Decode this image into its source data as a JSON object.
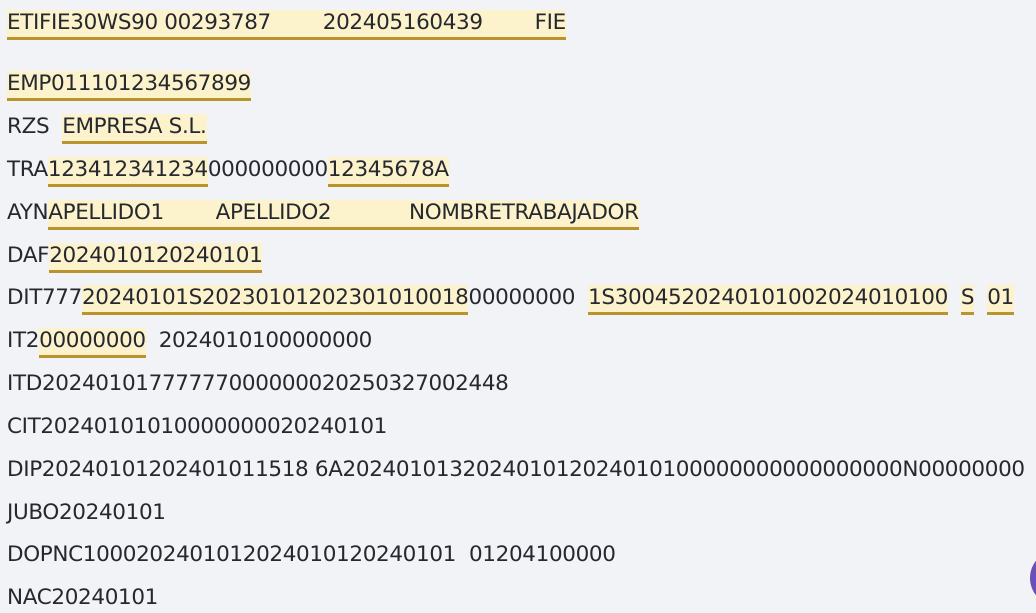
{
  "colors": {
    "background": "#f1f3f6",
    "highlight": "#fcf3cc",
    "underline": "#b9932e",
    "text": "#26282f",
    "fab": "#6a4fb8"
  },
  "lines": [
    [
      {
        "t": "ETIFIE30WS90 00293787        202405160439        FIE",
        "h": true
      }
    ],
    [
      {
        "t": "EMP01110123456789",
        "h": true
      },
      {
        "t": "9",
        "h": true
      }
    ],
    [
      {
        "t": "RZS  ",
        "h": false
      },
      {
        "t": "EMPRESA S.L.",
        "h": true
      }
    ],
    [
      {
        "t": "TRA",
        "h": false
      },
      {
        "t": "123412341234",
        "h": true
      },
      {
        "t": "000000000",
        "h": false
      },
      {
        "t": "12345678A",
        "h": true
      }
    ],
    [
      {
        "t": "AYN",
        "h": false
      },
      {
        "t": "APELLIDO1        APELLIDO2            NOMBRETRABAJADOR",
        "h": true
      }
    ],
    [
      {
        "t": "DAF",
        "h": false
      },
      {
        "t": "2024010120240101",
        "h": true
      }
    ],
    [
      {
        "t": "DIT777",
        "h": false
      },
      {
        "t": "20240101S20230101202301010018",
        "h": true
      },
      {
        "t": "00000000  ",
        "h": false
      },
      {
        "t": "1S3004520240101002024010100",
        "h": true
      },
      {
        "t": "  ",
        "h": false
      },
      {
        "t": "S",
        "h": true
      },
      {
        "t": "  ",
        "h": false
      },
      {
        "t": "01",
        "h": true
      }
    ],
    [
      {
        "t": "IT2",
        "h": false
      },
      {
        "t": "00000000",
        "h": true
      },
      {
        "t": "  2024010100000000",
        "h": false
      }
    ],
    [
      {
        "t": "ITD20240101777777000000020250327002448",
        "h": false
      }
    ],
    [
      {
        "t": "CIT20240101010000000020240101",
        "h": false
      }
    ],
    [
      {
        "t": "DIP20240101202401011518 6A202401013202401012024010100000000000000000N00000000",
        "h": false
      }
    ],
    [
      {
        "t": "JUBO20240101",
        "h": false
      }
    ],
    [
      {
        "t": "DOPNC1000202401012024010120240101  01204100000",
        "h": false
      }
    ],
    [
      {
        "t": "NAC20240101",
        "h": false
      }
    ]
  ]
}
